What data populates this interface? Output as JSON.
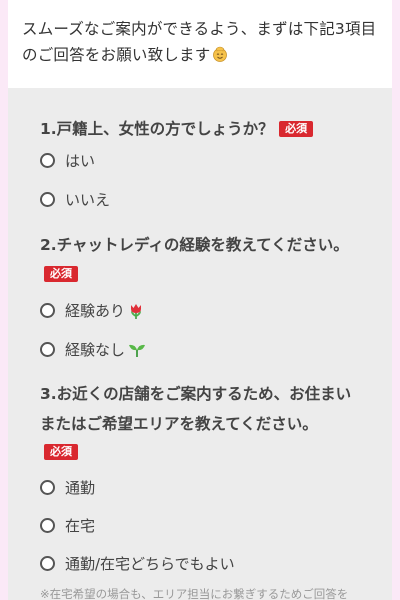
{
  "intro": {
    "text": "スムーズなご案内ができるよう、まずは下記3項目のご回答をお願い致します"
  },
  "required_label": "必須",
  "questions": [
    {
      "title": "1.戸籍上、女性の方でしょうか？",
      "options": [
        "はい",
        "いいえ"
      ]
    },
    {
      "title": "2.チャットレディの経験を教えてください。",
      "options": [
        "経験あり",
        "経験なし"
      ]
    },
    {
      "title_line1": "3.お近くの店舗をご案内するため、お住まい",
      "title_line2": "またはご希望エリアを教えてください。",
      "options": [
        "通勤",
        "在宅",
        "通勤/在宅どちらでもよい"
      ]
    }
  ],
  "note": "※在宅希望の場合も、エリア担当にお繋ぎするためご回答を",
  "icons": {
    "intro_emoji": "smiling-face-icon",
    "experience_yes": "tulip-icon",
    "experience_no": "seedling-icon"
  },
  "colors": {
    "required_badge": "#d9282f",
    "panel_background": "#ececec",
    "page_background": "#fbe9f7"
  }
}
